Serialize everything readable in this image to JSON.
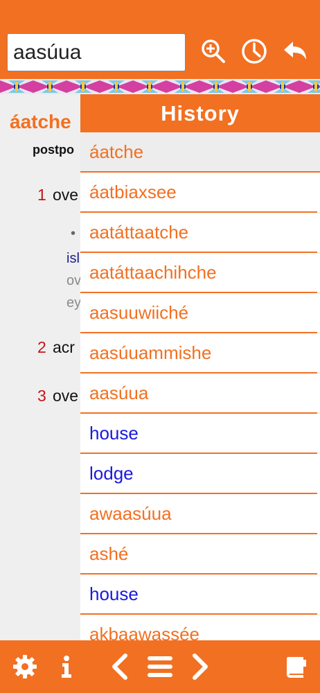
{
  "search": {
    "value": "aasúua"
  },
  "icons": {
    "zoom": "zoom-in-icon",
    "history": "clock-icon",
    "back": "back-arrow-icon",
    "settings": "gear-icon",
    "info": "info-icon",
    "prev": "chevron-left-icon",
    "menu": "menu-icon",
    "next": "chevron-right-icon",
    "book": "book-icon"
  },
  "colors": {
    "accent": "#f27021",
    "crow_word": "#f27021",
    "english_word": "#1a1ae0",
    "sense_number": "#c4141a"
  },
  "entry": {
    "headword": "áatche",
    "pos": "postpo",
    "senses": [
      {
        "num": "1",
        "text": "ove"
      },
      {
        "num": "2",
        "text": "acr"
      },
      {
        "num": "3",
        "text": "ove"
      }
    ],
    "example": {
      "bullet": "•",
      "line1": "isl",
      "line2": "ov",
      "line3": "ey"
    }
  },
  "history": {
    "title": "History",
    "items": [
      {
        "label": "áatche",
        "lang": "crow"
      },
      {
        "label": "áatbiaxsee",
        "lang": "crow"
      },
      {
        "label": "aatáttaatche",
        "lang": "crow"
      },
      {
        "label": "aatáttaachihche",
        "lang": "crow"
      },
      {
        "label": "aasuuwiiché",
        "lang": "crow"
      },
      {
        "label": "aasúuammishe",
        "lang": "crow"
      },
      {
        "label": "aasúua",
        "lang": "crow"
      },
      {
        "label": "house",
        "lang": "eng"
      },
      {
        "label": "lodge",
        "lang": "eng"
      },
      {
        "label": "awaasúua",
        "lang": "crow"
      },
      {
        "label": "ashé",
        "lang": "crow"
      },
      {
        "label": "house",
        "lang": "eng"
      },
      {
        "label": "akbaawassée",
        "lang": "crow"
      }
    ]
  }
}
